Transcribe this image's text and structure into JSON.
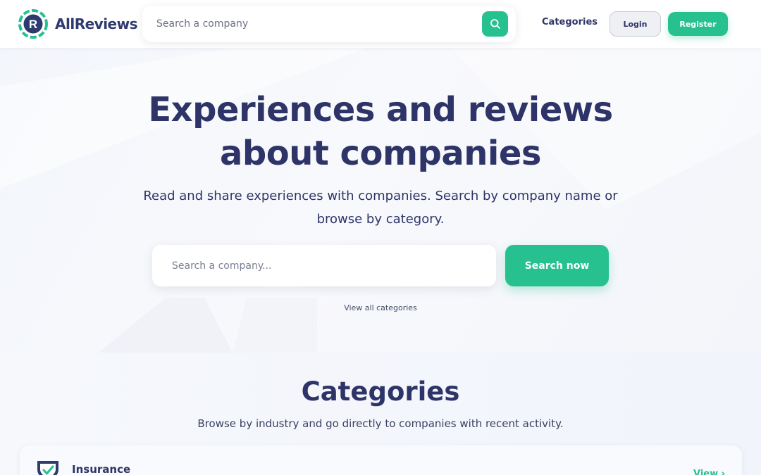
{
  "colors": {
    "brand_green": "#27c08f",
    "brand_navy": "#2e3468",
    "background": "#f6f8fc"
  },
  "header": {
    "logo_text": "AllReviews",
    "logo_icon": "r-badge-icon",
    "search_placeholder": "Search a company",
    "search_icon": "search-icon",
    "nav_categories": "Categories",
    "login_label": "Login",
    "register_label": "Register"
  },
  "hero": {
    "title": "Experiences and reviews about companies",
    "subtitle": "Read and share experiences with companies. Search by company name or browse by category.",
    "search_placeholder": "Search a company...",
    "search_button": "Search now",
    "view_all_link": "View all categories"
  },
  "categories": {
    "title": "Categories",
    "subtitle": "Browse by industry and go directly to companies with recent activity.",
    "items": [
      {
        "name": "Insurance",
        "icon": "shield-check-icon",
        "view_label": "View ›"
      }
    ]
  }
}
